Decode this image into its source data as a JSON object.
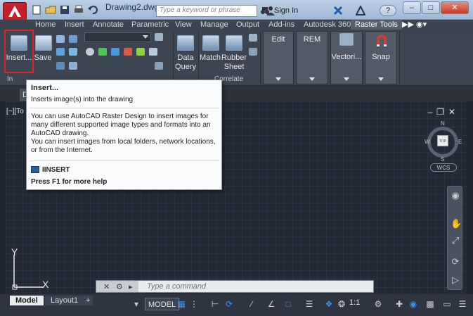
{
  "titlebar": {
    "doc_title": "Drawing2.dwg",
    "search_placeholder": "Type a keyword or phrase",
    "signin_label": "Sign In",
    "help_label": "?"
  },
  "tabs": [
    {
      "label": "Home"
    },
    {
      "label": "Insert"
    },
    {
      "label": "Annotate"
    },
    {
      "label": "Parametric"
    },
    {
      "label": "View"
    },
    {
      "label": "Manage"
    },
    {
      "label": "Output"
    },
    {
      "label": "Add-ins"
    },
    {
      "label": "Autodesk 360"
    },
    {
      "label": "Raster Tools"
    }
  ],
  "ribbon": {
    "insert_label": "Insert...",
    "save_label": "Save",
    "data_query_label": "Data\nQuery",
    "match_label": "Match",
    "rubber_sheet_label": "Rubber\nSheet",
    "edit_label": "Edit",
    "rem_label": "REM",
    "vectorize_label": "Vectori...",
    "snap_label": "Snap",
    "panel_correlate": "Correlate",
    "panel_insert_fragment": "In",
    "panel_mid_fragment": "...",
    "panel_right_fragment": "...",
    "doc_tab_fragment": "D"
  },
  "canvas": {
    "viewport_label": "[−][To",
    "compass": {
      "n": "N",
      "e": "E",
      "s": "S",
      "w": "W",
      "cube": "TOP"
    },
    "wcs_label": "WCS",
    "ucs_y": "Y",
    "ucs_x": "X",
    "command_placeholder": "Type a command"
  },
  "statusbar": {
    "layout_tabs": [
      {
        "label": "Model"
      },
      {
        "label": "Layout1"
      }
    ],
    "add_tab": "+",
    "model_label": "MODEL",
    "scale_label": "1:1"
  },
  "tooltip": {
    "title": "Insert...",
    "subtitle": "Inserts image(s) into the drawing",
    "body_1": "You can use AutoCAD Raster Design to insert images for many different supported image types and formats into an AutoCAD drawing.",
    "body_2": "You can insert images from local folders, network locations, or from the Internet.",
    "command": "IINSERT",
    "help": "Press F1 for more help"
  },
  "colors": {
    "accent_red": "#e1232e",
    "ribbon_bg": "#3e4552",
    "canvas_bg": "#232a36",
    "status_on": "#3e93e8"
  }
}
